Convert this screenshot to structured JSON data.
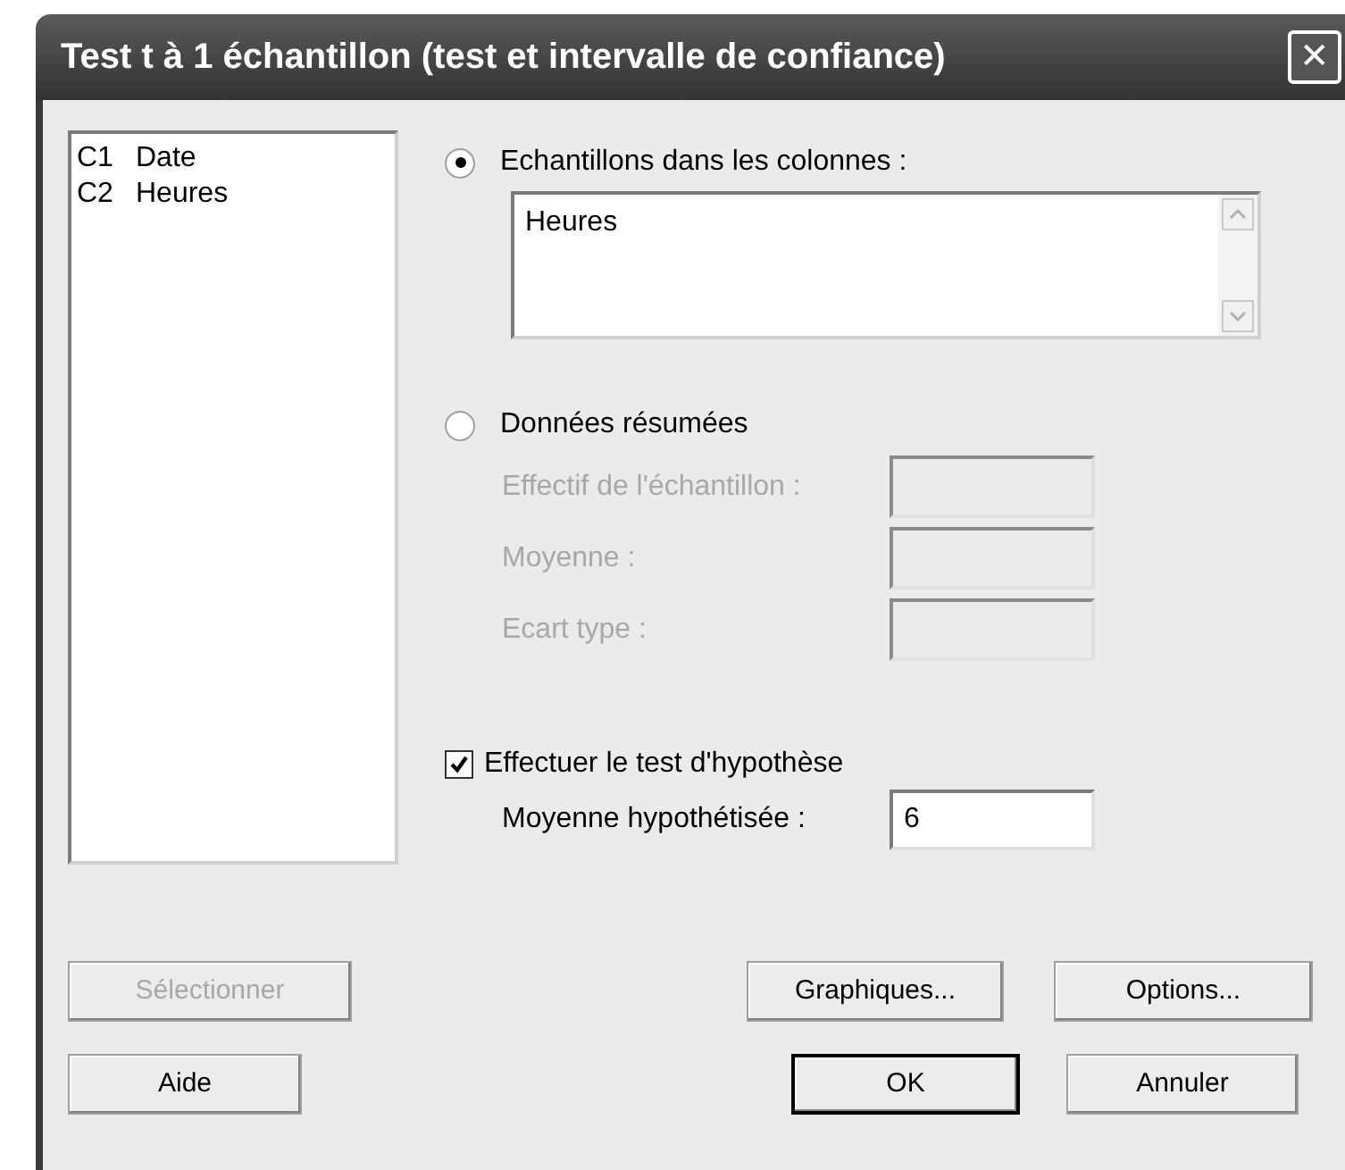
{
  "window": {
    "title": "Test t à 1 échantillon (test et intervalle de confiance)",
    "close": "✕"
  },
  "columns": [
    {
      "id": "C1",
      "name": "Date"
    },
    {
      "id": "C2",
      "name": "Heures"
    }
  ],
  "sample_columns": {
    "label": "Echantillons dans les colonnes :",
    "selected": true,
    "value": "Heures"
  },
  "summarized": {
    "label": "Données résumées",
    "selected": false,
    "fields": [
      {
        "label": "Effectif de l'échantillon :",
        "disabled": true
      },
      {
        "label": "Moyenne :",
        "disabled": true
      },
      {
        "label": "Ecart type :",
        "disabled": true
      }
    ]
  },
  "hypothesis": {
    "label": "Effectuer le test d'hypothèse",
    "checked": true,
    "mean_label": "Moyenne hypothétisée :",
    "mean_value": "6"
  },
  "buttons": [
    {
      "label": "Sélectionner",
      "disabled": true,
      "default": false
    },
    {
      "label": "Graphiques...",
      "disabled": false,
      "default": false
    },
    {
      "label": "Options...",
      "disabled": false,
      "default": false
    },
    {
      "label": "Aide",
      "disabled": false,
      "default": false
    },
    {
      "label": "OK",
      "disabled": false,
      "default": true
    },
    {
      "label": "Annuler",
      "disabled": false,
      "default": false
    }
  ]
}
